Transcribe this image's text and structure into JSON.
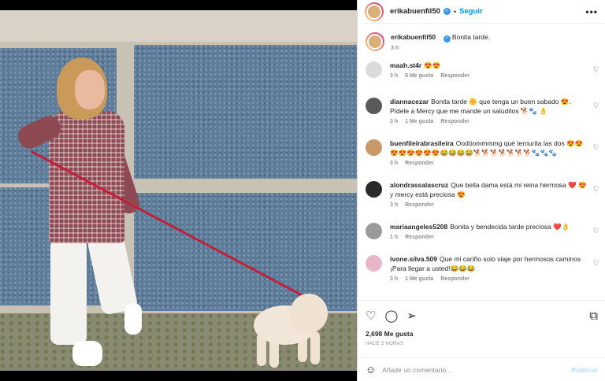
{
  "post": {
    "author": "erikabuenfil50",
    "follow_label": "Seguir",
    "separator": "•",
    "more_label": "•••",
    "caption_text": "Bonita tarde.",
    "caption_time": "3 h"
  },
  "comments": [
    {
      "user": "maah.st4r",
      "text": "😍😍",
      "time": "3 h",
      "likes": "6 Me gusta",
      "reply": "Responder",
      "avatar_color": "#dbdbdb"
    },
    {
      "user": "diannacezar",
      "text": "Bonita tarde 🌼 que tenga un buen sabado 😍. Pídele a Mercy que me mande un saluditos 🐕🐾 👌",
      "time": "3 h",
      "likes": "1 Me gusta",
      "reply": "Responder",
      "avatar_color": "#5a5a5a"
    },
    {
      "user": "buenfileirabrasileira",
      "text": "Oodóommmmg qué ternurita las dos 😍😍😍😍😍😍😍😍😂😂😂😂🐕🐕🐕🐕🐕🐕🐕🐾🐾🐾",
      "time": "3 h",
      "likes": "",
      "reply": "Responder",
      "avatar_color": "#c89a6a"
    },
    {
      "user": "alondrassalascruz",
      "text": "Que bella dama está mi reina hermosa ❤️ 😍 y mercy está preciosa 😍",
      "time": "3 h",
      "likes": "",
      "reply": "Responder",
      "avatar_color": "#2a2a2a"
    },
    {
      "user": "mariaangeles5208",
      "text": "Bonita y bendecida tarde preciosa ❤️👌",
      "time": "1 h",
      "likes": "",
      "reply": "Responder",
      "avatar_color": "#9a9a9a"
    },
    {
      "user": "ivone.silva.509",
      "text": "Que mi cariño solo viaje por hermosos caminos ¡Para llegar a usted!😂😂😂",
      "time": "3 h",
      "likes": "1 Me gusta",
      "reply": "Responder",
      "avatar_color": "#e7b7c9"
    }
  ],
  "actions": {
    "likes": "2,698 Me gusta",
    "time": "HACE 3 HORAS",
    "placeholder": "Añade un comentario...",
    "publish": "Publicar"
  },
  "icons": {
    "heart": "♡",
    "comment": "◯",
    "share": "➢",
    "save": "⧉",
    "emoji": "☺",
    "verified": "✓"
  },
  "colors": {
    "accent": "#0095f6",
    "publish_disabled": "#b2dffc",
    "verified": "#3897f0"
  }
}
